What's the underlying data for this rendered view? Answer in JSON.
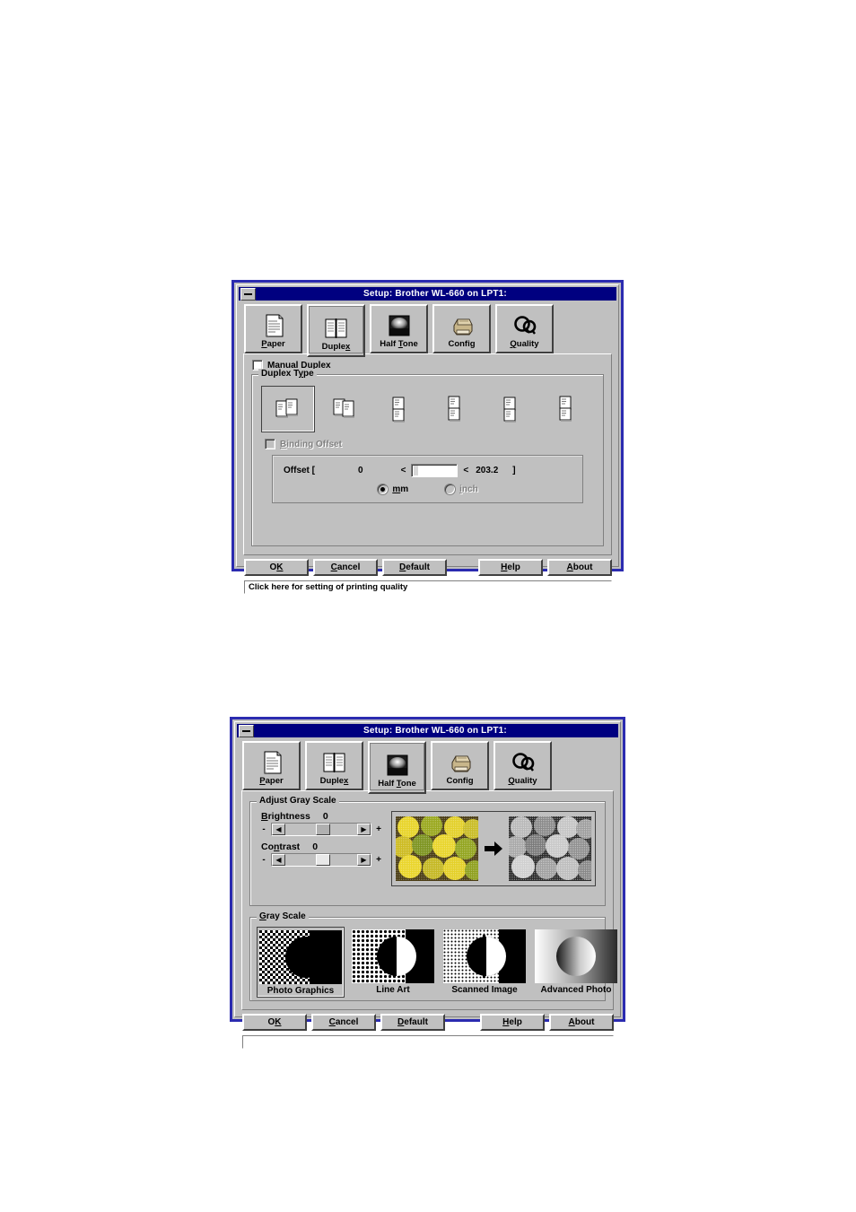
{
  "dialog1": {
    "title": "Setup: Brother WL-660 on LPT1:",
    "tabs": [
      {
        "label": "Paper",
        "accel_pre": "",
        "accel": "P",
        "accel_post": "aper",
        "icon": "paper-icon",
        "selected": false
      },
      {
        "label": "Duplex",
        "accel_pre": "Duple",
        "accel": "x",
        "accel_post": "",
        "icon": "duplex-book-icon",
        "selected": true
      },
      {
        "label": "Half Tone",
        "accel_pre": "Half ",
        "accel": "T",
        "accel_post": "one",
        "icon": "halftone-icon",
        "selected": false
      },
      {
        "label": "Config",
        "accel_pre": "Config",
        "accel": "",
        "accel_post": "",
        "icon": "printer-icon",
        "selected": false
      },
      {
        "label": "Quality",
        "accel_pre": "",
        "accel": "Q",
        "accel_post": "uality",
        "icon": "quality-qq-icon",
        "selected": false
      }
    ],
    "manual_duplex": {
      "label_pre": "",
      "accel": "M",
      "label_post": "anual Duplex",
      "checked": false
    },
    "duplex_type": {
      "legend_pre": "Duplex T",
      "legend_accel": "y",
      "legend_post": "pe",
      "options": [
        {
          "name": "flip-long-edge-left",
          "selected": true
        },
        {
          "name": "flip-long-edge-right",
          "selected": false
        },
        {
          "name": "flip-short-edge-top-a",
          "selected": false
        },
        {
          "name": "flip-short-edge-top-b",
          "selected": false
        },
        {
          "name": "flip-short-edge-bottom-a",
          "selected": false
        },
        {
          "name": "flip-short-edge-bottom-b",
          "selected": false
        }
      ]
    },
    "binding_offset": {
      "label_pre": "",
      "accel": "B",
      "label_post": "inding Offset",
      "checked": false,
      "enabled": false,
      "offset_label": "Offset [",
      "min": "0",
      "lt1": "<",
      "value": "",
      "lt2": "<",
      "max": "203.2",
      "close_bracket": "]",
      "units": [
        {
          "label_pre": "",
          "accel": "m",
          "label_post": "m",
          "full": "mm",
          "selected": true
        },
        {
          "label_pre": "",
          "accel": "i",
          "label_post": "nch",
          "full": "inch",
          "selected": false
        }
      ]
    },
    "buttons": [
      {
        "name": "ok-button",
        "pre": "O",
        "accel": "K",
        "post": ""
      },
      {
        "name": "cancel-button",
        "pre": "",
        "accel": "C",
        "post": "ancel"
      },
      {
        "name": "default-button",
        "pre": "",
        "accel": "D",
        "post": "efault"
      },
      {
        "name": "help-button",
        "pre": "",
        "accel": "H",
        "post": "elp"
      },
      {
        "name": "about-button",
        "pre": "",
        "accel": "A",
        "post": "bout"
      }
    ],
    "status": "Click here for setting of printing quality"
  },
  "dialog2": {
    "title": "Setup: Brother WL-660 on LPT1:",
    "tabs": [
      {
        "label": "Paper",
        "accel_pre": "",
        "accel": "P",
        "accel_post": "aper",
        "icon": "paper-icon",
        "selected": false
      },
      {
        "label": "Duplex",
        "accel_pre": "Duple",
        "accel": "x",
        "accel_post": "",
        "icon": "duplex-book-icon",
        "selected": false
      },
      {
        "label": "Half Tone",
        "accel_pre": "Half ",
        "accel": "T",
        "accel_post": "one",
        "icon": "halftone-icon",
        "selected": true
      },
      {
        "label": "Config",
        "accel_pre": "Config",
        "accel": "",
        "accel_post": "",
        "icon": "printer-icon",
        "selected": false
      },
      {
        "label": "Quality",
        "accel_pre": "",
        "accel": "Q",
        "accel_post": "uality",
        "icon": "quality-qq-icon",
        "selected": false
      }
    ],
    "adjust_gray_scale": {
      "legend": "Adjust Gray Scale",
      "brightness": {
        "label_pre": "",
        "accel": "B",
        "label_post": "rightness",
        "value": "0",
        "minus": "-",
        "plus": "+",
        "thumb_pct": 44
      },
      "contrast": {
        "label_pre": "Co",
        "accel": "n",
        "label_post": "trast",
        "value": "0",
        "minus": "-",
        "plus": "+",
        "thumb_pct": 44
      },
      "preview": {
        "source_alt": "color-fruit-photo",
        "result_alt": "grayscale-fruit-photo",
        "arrow": "right-arrow-icon"
      }
    },
    "gray_scale": {
      "legend_pre": "",
      "legend_accel": "G",
      "legend_post": "ray Scale",
      "options": [
        {
          "label": "Photo Graphics",
          "name": "photo-graphics",
          "selected": true,
          "pattern": "checker"
        },
        {
          "label": "Line Art",
          "name": "line-art",
          "selected": false,
          "pattern": "lineart"
        },
        {
          "label": "Scanned Image",
          "name": "scanned-image",
          "selected": false,
          "pattern": "scanned"
        },
        {
          "label": "Advanced Photo",
          "name": "advanced-photo",
          "selected": false,
          "pattern": "advanced"
        }
      ]
    },
    "buttons": [
      {
        "name": "ok-button",
        "pre": "O",
        "accel": "K",
        "post": ""
      },
      {
        "name": "cancel-button",
        "pre": "",
        "accel": "C",
        "post": "ancel"
      },
      {
        "name": "default-button",
        "pre": "",
        "accel": "D",
        "post": "efault"
      },
      {
        "name": "help-button",
        "pre": "",
        "accel": "H",
        "post": "elp"
      },
      {
        "name": "about-button",
        "pre": "",
        "accel": "A",
        "post": "bout"
      }
    ],
    "status": ""
  },
  "colors": {
    "titlebar": "#000080",
    "window_border": "#2b2bb0",
    "face": "#c0c0c0",
    "shadow": "#808080",
    "dark": "#404040",
    "light": "#ffffff",
    "page_bg": "#ffffff"
  }
}
